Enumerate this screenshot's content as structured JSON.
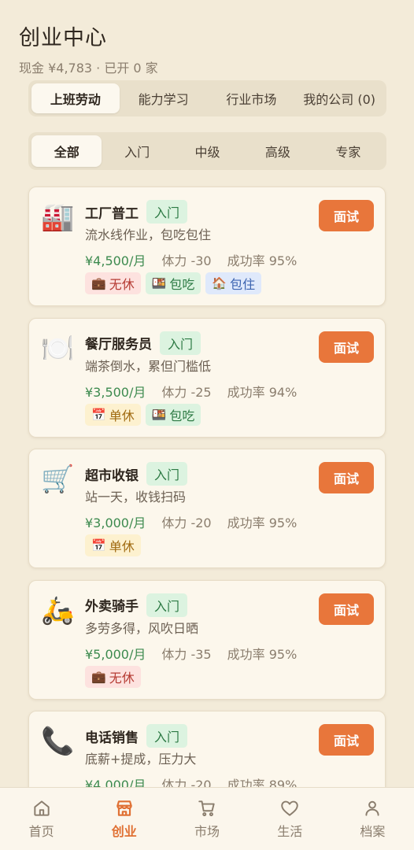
{
  "header": {
    "title": "创业中心",
    "subtitle": "现金 ¥4,783 · 已开 0 家"
  },
  "tabs": [
    {
      "label": "上班劳动",
      "active": true
    },
    {
      "label": "能力学习"
    },
    {
      "label": "行业市场"
    },
    {
      "label": "我的公司 (0)"
    }
  ],
  "levels": [
    {
      "label": "全部",
      "active": true
    },
    {
      "label": "入门"
    },
    {
      "label": "中级"
    },
    {
      "label": "高级"
    },
    {
      "label": "专家"
    }
  ],
  "jobs": [
    {
      "icon": "🏭",
      "title": "工厂普工",
      "level": "入门",
      "desc": "流水线作业，包吃包住",
      "salary": "¥4,500/月",
      "stamina": "体力 -30",
      "rate": "成功率 95%",
      "tags": [
        {
          "icon": "💼",
          "label": "无休"
        },
        {
          "icon": "🍱",
          "label": "包吃"
        },
        {
          "icon": "🏠",
          "label": "包住"
        }
      ],
      "button": "面试"
    },
    {
      "icon": "🍽️",
      "title": "餐厅服务员",
      "level": "入门",
      "desc": "端茶倒水，累但门槛低",
      "salary": "¥3,500/月",
      "stamina": "体力 -25",
      "rate": "成功率 94%",
      "tags": [
        {
          "icon": "📅",
          "label": "单休"
        },
        {
          "icon": "🍱",
          "label": "包吃"
        }
      ],
      "button": "面试"
    },
    {
      "icon": "🛒",
      "title": "超市收银",
      "level": "入门",
      "desc": "站一天，收钱扫码",
      "salary": "¥3,000/月",
      "stamina": "体力 -20",
      "rate": "成功率 95%",
      "tags": [
        {
          "icon": "📅",
          "label": "单休"
        }
      ],
      "button": "面试"
    },
    {
      "icon": "🛵",
      "title": "外卖骑手",
      "level": "入门",
      "desc": "多劳多得，风吹日晒",
      "salary": "¥5,000/月",
      "stamina": "体力 -35",
      "rate": "成功率 95%",
      "tags": [
        {
          "icon": "💼",
          "label": "无休"
        }
      ],
      "button": "面试"
    },
    {
      "icon": "📞",
      "title": "电话销售",
      "level": "入门",
      "desc": "底薪+提成，压力大",
      "salary": "¥4,000/月",
      "stamina": "体力 -20",
      "rate": "成功率 89%",
      "tags": [],
      "button": "面试"
    }
  ],
  "nav": [
    {
      "label": "首页",
      "icon": "home-icon"
    },
    {
      "label": "创业",
      "icon": "store-icon",
      "active": true
    },
    {
      "label": "市场",
      "icon": "cart-icon"
    },
    {
      "label": "生活",
      "icon": "heart-icon"
    },
    {
      "label": "档案",
      "icon": "person-icon"
    }
  ],
  "colors": {
    "accent": "#e8763b",
    "background": "#f3ebd9",
    "card": "#fcf7ec",
    "salary": "#3c8a4e"
  }
}
